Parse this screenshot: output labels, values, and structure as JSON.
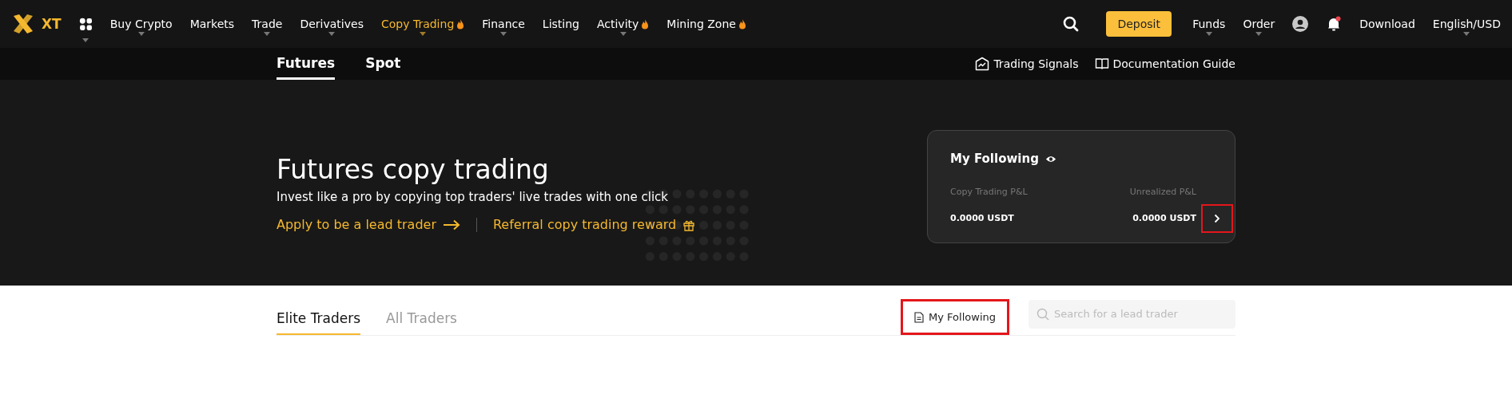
{
  "top_nav": {
    "logo": "XT",
    "items": [
      {
        "label": "Buy Crypto",
        "dropdown": true,
        "hot": false,
        "selected": false
      },
      {
        "label": "Markets",
        "dropdown": false,
        "hot": false,
        "selected": false
      },
      {
        "label": "Trade",
        "dropdown": true,
        "hot": false,
        "selected": false
      },
      {
        "label": "Derivatives",
        "dropdown": true,
        "hot": false,
        "selected": false
      },
      {
        "label": "Copy Trading",
        "dropdown": true,
        "hot": true,
        "selected": true
      },
      {
        "label": "Finance",
        "dropdown": true,
        "hot": false,
        "selected": false
      },
      {
        "label": "Listing",
        "dropdown": false,
        "hot": false,
        "selected": false
      },
      {
        "label": "Activity",
        "dropdown": true,
        "hot": true,
        "selected": false
      },
      {
        "label": "Mining Zone",
        "dropdown": false,
        "hot": true,
        "selected": false
      }
    ],
    "deposit": "Deposit",
    "right_items": [
      {
        "label": "Funds",
        "dropdown": true
      },
      {
        "label": "Order",
        "dropdown": true
      }
    ],
    "notification_dot": true,
    "download": "Download",
    "language": {
      "label": "English/USD",
      "dropdown": true
    }
  },
  "sub_nav": {
    "tabs": [
      {
        "label": "Futures",
        "selected": true
      },
      {
        "label": "Spot",
        "selected": false
      }
    ],
    "links": [
      {
        "label": "Trading Signals",
        "kind": "signals"
      },
      {
        "label": "Documentation Guide",
        "kind": "guide"
      }
    ]
  },
  "hero": {
    "title": "Futures copy trading",
    "subtitle": "Invest like a pro by copying top traders' live trades with one click",
    "links": [
      {
        "label": "Apply to be a lead trader",
        "kind": "arrow"
      },
      {
        "label": "Referral copy trading reward",
        "kind": "gift"
      }
    ],
    "card": {
      "title": "My Following",
      "stats": [
        {
          "label": "Copy Trading P&L",
          "value": "0.0000 USDT"
        },
        {
          "label": "Unrealized P&L",
          "value": "0.0000 USDT"
        }
      ],
      "arrow_highlighted": true
    }
  },
  "traders": {
    "tabs": [
      {
        "label": "Elite Traders",
        "selected": true
      },
      {
        "label": "All Traders",
        "selected": false
      }
    ],
    "my_following": {
      "label": "My Following",
      "highlighted": true
    },
    "search": {
      "placeholder": "Search for a lead trader"
    }
  }
}
